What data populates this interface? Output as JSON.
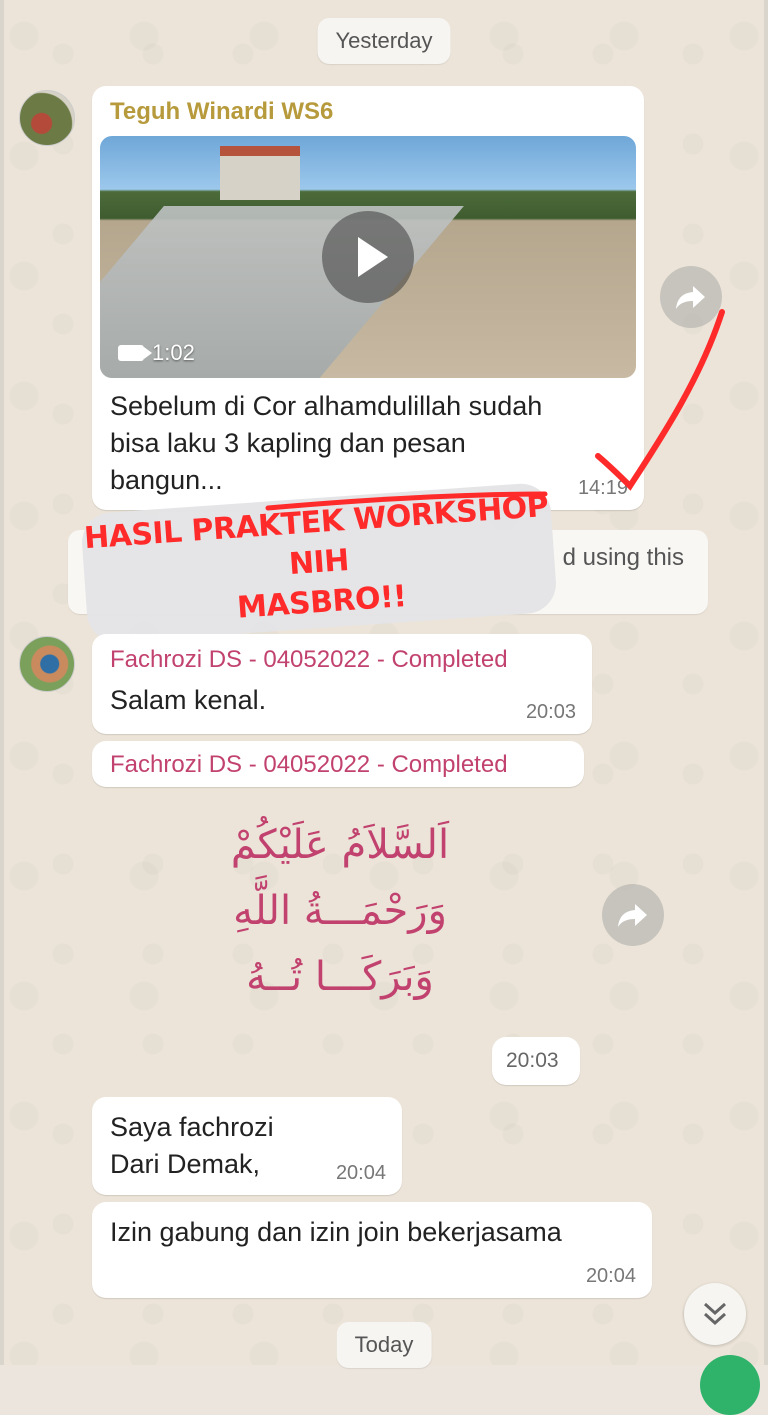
{
  "date_chips": {
    "yesterday": "Yesterday",
    "today": "Today"
  },
  "messages": {
    "teguh": {
      "sender": "Teguh Winardi WS6",
      "video_duration": "1:02",
      "caption": "Sebelum di Cor alhamdulillah sudah\nbisa laku 3 kapling dan pesan\nbangun...",
      "time": "14:19"
    },
    "system_note_fragment": "d using this",
    "fachrozi_1": {
      "sender": "Fachrozi DS - 04052022 - Completed",
      "text": "Salam kenal.",
      "time": "20:03"
    },
    "fachrozi_sticker": {
      "sender": "Fachrozi DS - 04052022 - Completed",
      "arabic": "اَلسَّلاَمُ عَلَيْكُمْ\nوَرَحْمَـــةُ اللَّهِ\nوَبَرَكَـــا تُــهُ",
      "time": "20:03"
    },
    "fachrozi_2": {
      "text": "Saya fachrozi\nDari Demak,",
      "time": "20:04"
    },
    "fachrozi_3": {
      "text": "Izin gabung dan izin join bekerjasama",
      "time": "20:04"
    }
  },
  "overlay": {
    "text": "HASIL PRAKTEK WORKSHOP NIH\nMASBRO!!"
  },
  "icons": {
    "forward": "forward-arrow-icon",
    "scroll": "double-chevron-down-icon",
    "play": "play-icon",
    "video": "video-camera-icon"
  },
  "colors": {
    "chat_background": "#ece4d8",
    "teguh_name": "#b69a3c",
    "fachrozi_name": "#c2426f",
    "annotation_red": "#ff2a2a"
  }
}
